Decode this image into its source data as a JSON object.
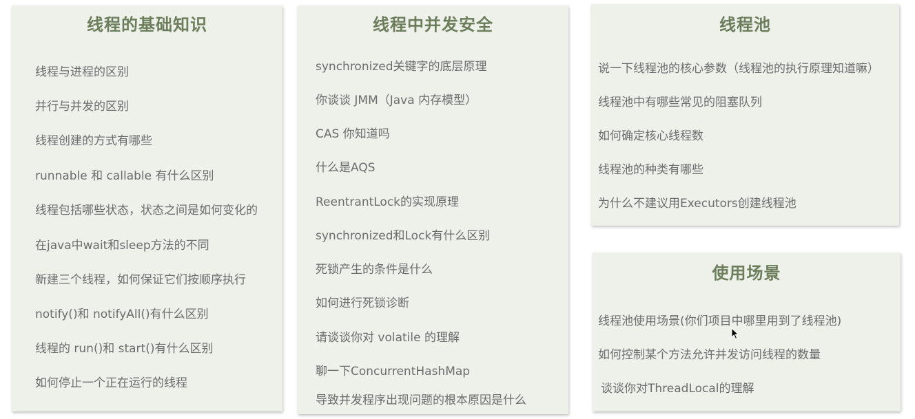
{
  "cards": [
    {
      "title": "线程的基础知识",
      "items": [
        "线程与进程的区别",
        "并行与并发的区别",
        "线程创建的方式有哪些",
        "runnable 和 callable 有什么区别",
        "线程包括哪些状态，状态之间是如何变化的",
        "在java中wait和sleep方法的不同",
        "新建三个线程，如何保证它们按顺序执行",
        "notify()和 notifyAll()有什么区别",
        "线程的 run()和 start()有什么区别",
        "如何停止一个正在运行的线程"
      ]
    },
    {
      "title": "线程中并发安全",
      "items": [
        "synchronized关键字的底层原理",
        "你谈谈 JMM（Java 内存模型）",
        "CAS 你知道吗",
        "什么是AQS",
        "ReentrantLock的实现原理",
        "synchronized和Lock有什么区别",
        "死锁产生的条件是什么",
        "如何进行死锁诊断",
        "请谈谈你对 volatile 的理解",
        "聊一下ConcurrentHashMap",
        "导致并发程序出现问题的根本原因是什么"
      ]
    },
    {
      "title": "线程池",
      "items": [
        "说一下线程池的核心参数（线程池的执行原理知道嘛）",
        "线程池中有哪些常见的阻塞队列",
        "如何确定核心线程数",
        "线程池的种类有哪些",
        "为什么不建议用Executors创建线程池"
      ]
    },
    {
      "title": "使用场景",
      "items": [
        "线程池使用场景(你们项目中哪里用到了线程池)",
        "如何控制某个方法允许并发访问线程的数量",
        "谈谈你对ThreadLocal的理解"
      ]
    }
  ]
}
